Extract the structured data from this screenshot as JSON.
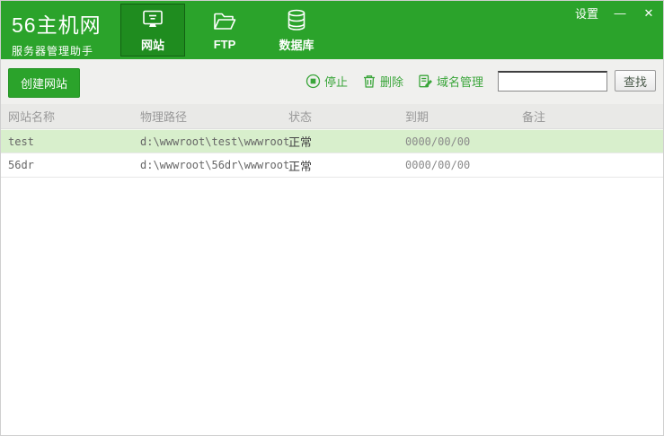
{
  "window": {
    "controls": {
      "settings": "设置",
      "minimize": "—",
      "close": "✕"
    }
  },
  "header": {
    "title": "56主机网",
    "subtitle": "服务器管理助手",
    "tabs": [
      {
        "label": "网站",
        "icon": "monitor-icon",
        "active": true
      },
      {
        "label": "FTP",
        "icon": "folder-icon",
        "active": false
      },
      {
        "label": "数据库",
        "icon": "database-icon",
        "active": false
      }
    ]
  },
  "toolbar": {
    "create_button": "创建网站",
    "stop_label": "停止",
    "delete_label": "删除",
    "domain_label": "域名管理",
    "search_value": "",
    "find_button": "查找"
  },
  "table": {
    "columns": [
      "网站名称",
      "物理路径",
      "状态",
      "到期",
      "备注"
    ],
    "rows": [
      {
        "name": "test",
        "path": "d:\\wwwroot\\test\\wwwroot",
        "status": "正常",
        "expiry": "0000/00/00",
        "note": "",
        "selected": true
      },
      {
        "name": "56dr",
        "path": "d:\\wwwroot\\56dr\\wwwroot",
        "status": "正常",
        "expiry": "0000/00/00",
        "note": "",
        "selected": false
      }
    ]
  },
  "colors": {
    "header_green": "#2ba32b",
    "active_tab_green": "#1f8c1f",
    "accent_green": "#3aa53a",
    "selected_row_green": "#d8efcc",
    "toolbar_gray": "#f0f0ee"
  }
}
